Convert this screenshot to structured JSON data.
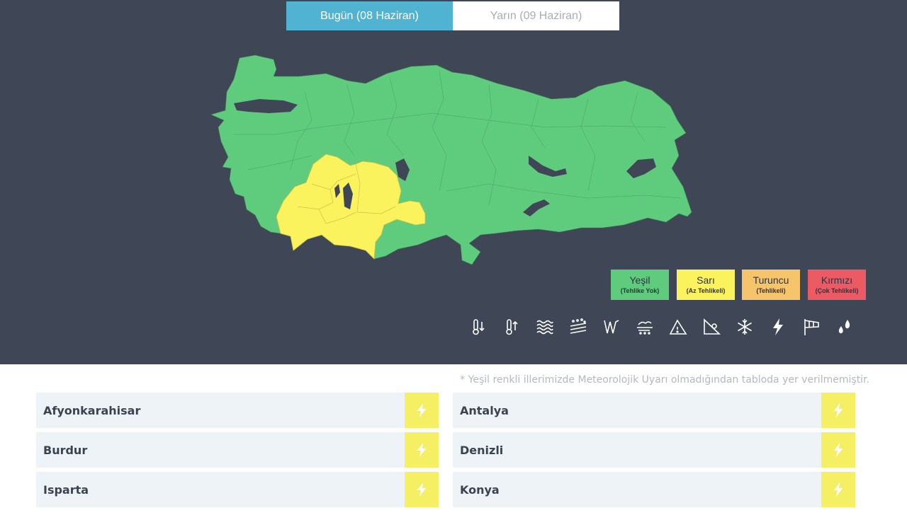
{
  "tabs": [
    {
      "label": "Bugün (08 Haziran)",
      "active": true
    },
    {
      "label": "Yarın (09 Haziran)",
      "active": false
    }
  ],
  "legend": [
    {
      "title": "Yeşil",
      "subtitle": "(Tehlike Yok)",
      "color": "#5fcc7d"
    },
    {
      "title": "Sarı",
      "subtitle": "(Az Tehlikeli)",
      "color": "#fbf35e"
    },
    {
      "title": "Turuncu",
      "subtitle": "(Tehlikeli)",
      "color": "#f6c46a"
    },
    {
      "title": "Kırmızı",
      "subtitle": "(Çok Tehlikeli)",
      "color": "#ec5a64"
    }
  ],
  "hazard_icons": [
    "cold-thermometer-icon",
    "hot-thermometer-icon",
    "fog-icon",
    "dust-icon",
    "rain-icon",
    "wind-icon",
    "avalanche-icon",
    "landslide-icon",
    "snow-icon",
    "lightning-icon",
    "windsock-icon",
    "hail-icon"
  ],
  "map": {
    "green_color": "#5fcc7d",
    "yellow_color": "#fbf35e",
    "water_color": "#3f4756"
  },
  "note": "* Yeşil renkli illerimizde Meteorolojik Uyarı olmadığından tabloda yer verilmemiştir.",
  "warnings": [
    {
      "province": "Afyonkarahisar",
      "icon": "lightning-icon"
    },
    {
      "province": "Antalya",
      "icon": "lightning-icon"
    },
    {
      "province": "Burdur",
      "icon": "lightning-icon"
    },
    {
      "province": "Denizli",
      "icon": "lightning-icon"
    },
    {
      "province": "Isparta",
      "icon": "lightning-icon"
    },
    {
      "province": "Konya",
      "icon": "lightning-icon"
    }
  ]
}
